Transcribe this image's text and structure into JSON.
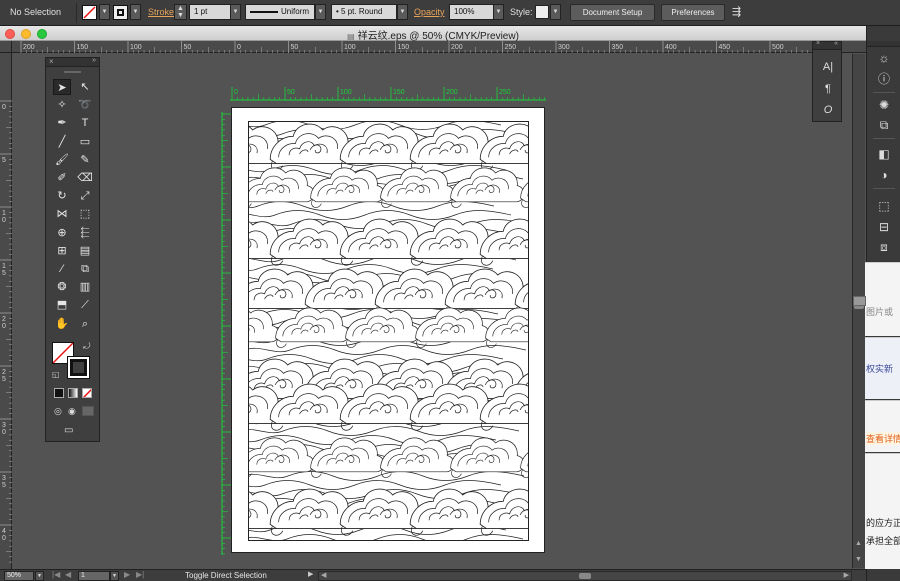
{
  "control_bar": {
    "selection_label": "No Selection",
    "stroke_label": "Stroke",
    "stroke_weight": "1 pt",
    "profile": "Uniform",
    "brush": "5 pt. Round",
    "opacity_label": "Opacity",
    "opacity_value": "100%",
    "style_label": "Style:",
    "document_setup": "Document Setup",
    "preferences": "Preferences"
  },
  "window": {
    "title": "祥云纹.eps @ 50% (CMYK/Preview)"
  },
  "top_ruler": {
    "ticks": [
      "200",
      "150",
      "100",
      "50",
      "0",
      "50",
      "100",
      "150",
      "200",
      "250",
      "300",
      "350",
      "400",
      "450",
      "500"
    ]
  },
  "left_ruler": {
    "ticks": [
      "0",
      "5",
      "1\n0",
      "1\n5",
      "2\n0",
      "2\n5",
      "3\n0",
      "3\n5",
      "4\n0",
      "4\n5"
    ]
  },
  "artboard_ruler": {
    "h_ticks": [
      "0",
      "50",
      "100",
      "150",
      "200",
      "250"
    ],
    "v_ticks": [
      "0",
      "50",
      "100",
      "150",
      "200",
      "250",
      "300",
      "350",
      "400"
    ]
  },
  "right_panel": {
    "icons": [
      "character-icon",
      "paragraph-icon",
      "opentype-icon"
    ]
  },
  "dock_strips": {
    "s1": "图片或",
    "s2": "权实新",
    "s3": "查看详情",
    "s4": "的应方正",
    "s5": "承担全部"
  },
  "status_bar": {
    "zoom": "50%",
    "artboard": "1",
    "message": "Toggle Direct Selection"
  },
  "colors": {
    "ruler_guide": "#19d43a",
    "accent_link": "#e8a35a"
  }
}
